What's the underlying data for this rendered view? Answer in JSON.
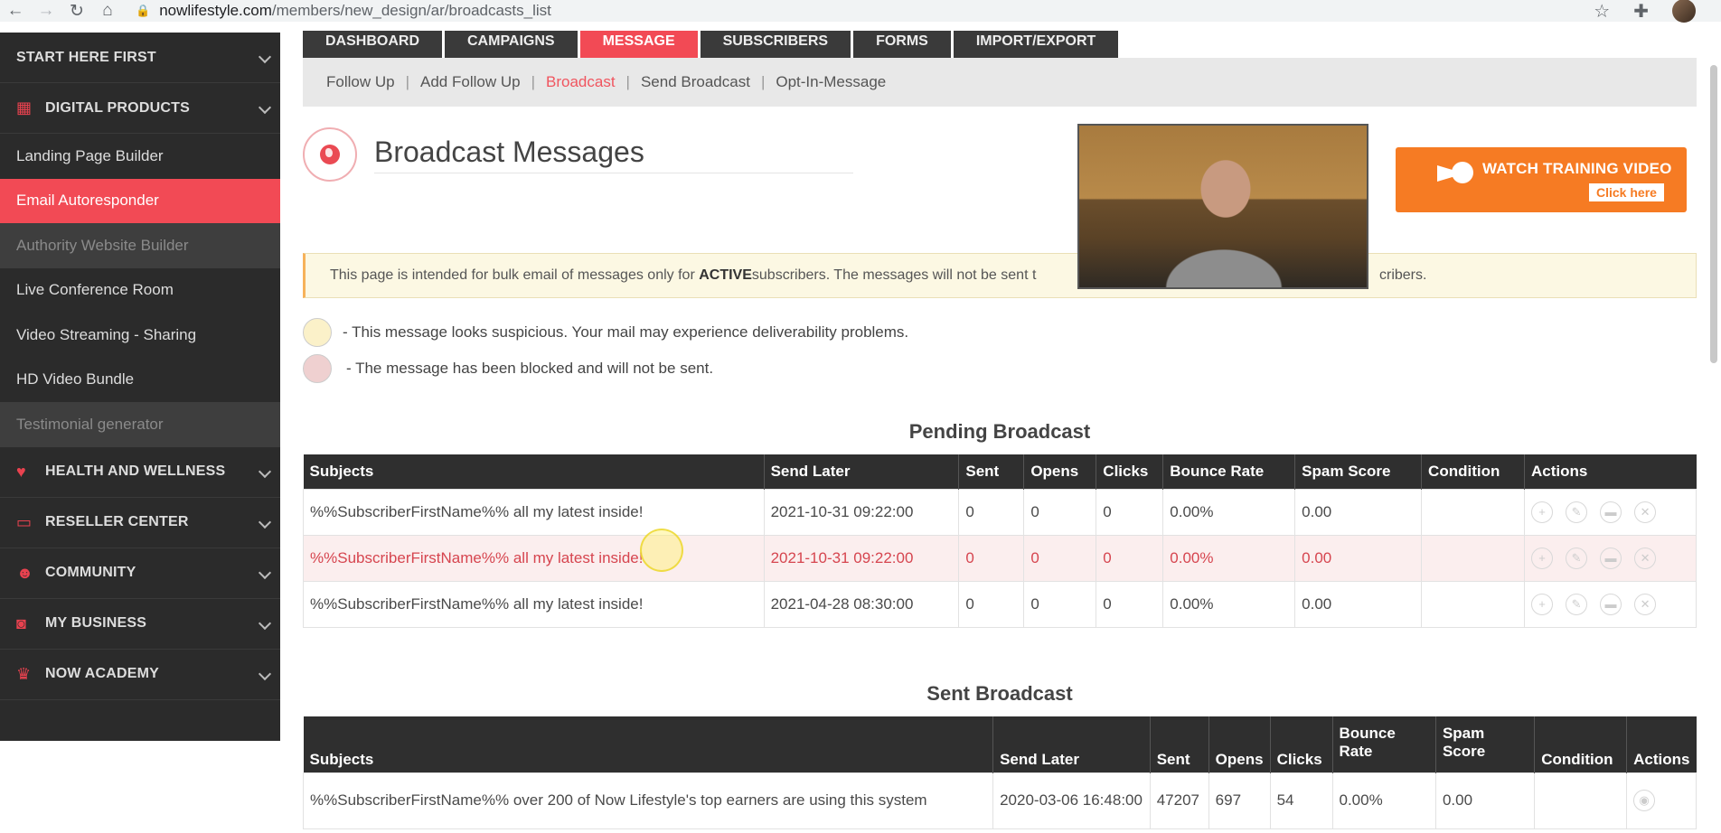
{
  "browser": {
    "host": "nowlifestyle.com",
    "path": "/members/new_design/ar/broadcasts_list"
  },
  "sidebar": {
    "items": [
      {
        "label": "START HERE FIRST",
        "icon": "",
        "type": "group"
      },
      {
        "label": "DIGITAL PRODUCTS",
        "icon": "▦",
        "type": "group"
      },
      {
        "label": "Landing Page Builder",
        "type": "sub"
      },
      {
        "label": "Email Autoresponder",
        "type": "sub-active"
      },
      {
        "label": "Authority Website Builder",
        "type": "sub-disabled"
      },
      {
        "label": "Live Conference Room",
        "type": "sub"
      },
      {
        "label": "Video Streaming - Sharing",
        "type": "sub"
      },
      {
        "label": "HD Video Bundle",
        "type": "sub"
      },
      {
        "label": "Testimonial generator",
        "type": "sub-disabled"
      },
      {
        "label": "HEALTH AND WELLNESS",
        "icon": "♥",
        "type": "group"
      },
      {
        "label": "RESELLER CENTER",
        "icon": "▭",
        "type": "group"
      },
      {
        "label": "COMMUNITY",
        "icon": "☻",
        "type": "group"
      },
      {
        "label": "MY BUSINESS",
        "icon": "◙",
        "type": "group"
      },
      {
        "label": "NOW ACADEMY",
        "icon": "♛",
        "type": "group"
      }
    ]
  },
  "tabs": [
    "DASHBOARD",
    "CAMPAIGNS",
    "MESSAGE",
    "SUBSCRIBERS",
    "FORMS",
    "IMPORT/EXPORT"
  ],
  "subnav": [
    "Follow Up",
    "Add Follow Up",
    "Broadcast",
    "Send Broadcast",
    "Opt-In-Message"
  ],
  "page_title": "Broadcast Messages",
  "watch_video": {
    "title": "WATCH TRAINING VIDEO",
    "sub": "Click here"
  },
  "notice": {
    "pre": "This page is intended for bulk email of messages only for ",
    "bold": "ACTIVE",
    "post": " subscribers. The messages will not be sent t",
    "tail": "cribers."
  },
  "legend": {
    "suspicious": "- This message looks suspicious. Your mail may experience deliverability problems.",
    "blocked": "- The message has been blocked and will not be sent.",
    "suspicious_color": "#fbf1c9",
    "blocked_color": "#efd0d0"
  },
  "pending": {
    "title": "Pending Broadcast",
    "headers": [
      "Subjects",
      "Send Later",
      "Sent",
      "Opens",
      "Clicks",
      "Bounce Rate",
      "Spam Score",
      "Condition",
      "Actions"
    ],
    "rows": [
      {
        "subject": "%%SubscriberFirstName%% all my latest inside!",
        "send_later": "2021-10-31 09:22:00",
        "sent": "0",
        "opens": "0",
        "clicks": "0",
        "bounce": "0.00%",
        "spam": "0.00",
        "condition": ""
      },
      {
        "subject": "%%SubscriberFirstName%% all my latest inside!",
        "send_later": "2021-10-31 09:22:00",
        "sent": "0",
        "opens": "0",
        "clicks": "0",
        "bounce": "0.00%",
        "spam": "0.00",
        "condition": ""
      },
      {
        "subject": "%%SubscriberFirstName%% all my latest inside!",
        "send_later": "2021-04-28 08:30:00",
        "sent": "0",
        "opens": "0",
        "clicks": "0",
        "bounce": "0.00%",
        "spam": "0.00",
        "condition": ""
      }
    ]
  },
  "sent": {
    "title": "Sent Broadcast",
    "headers": [
      "Subjects",
      "Send Later",
      "Sent",
      "Opens",
      "Clicks",
      "Bounce Rate",
      "Spam Score",
      "Condition",
      "Actions"
    ],
    "rows": [
      {
        "subject": "%%SubscriberFirstName%% over 200 of Now Lifestyle's top earners are using this system",
        "send_later": "2020-03-06 16:48:00",
        "sent": "47207",
        "opens": "697",
        "clicks": "54",
        "bounce": "0.00%",
        "spam": "0.00",
        "condition": ""
      }
    ]
  }
}
